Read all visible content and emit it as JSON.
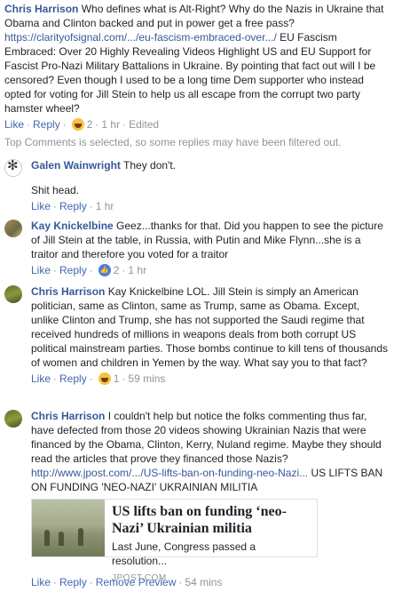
{
  "first_comment": {
    "author": "Chris Harrison",
    "text_part1": " Who defines what is Alt-Right? Why do the Nazis in Ukraine that Obama and Clinton backed and put in power get a free pass? ",
    "link": "https://clarityofsignal.com/.../eu-fascism-embraced-over.../",
    "text_part2": " EU Fascism Embraced: Over 20 Highly Revealing Videos Highlight US and EU Support for Fascist Pro-Nazi Military Battalions in Ukraine. By pointing that fact out will I be censored? Even though I used to be a long time Dem supporter who instead opted for voting for Jill Stein to help us all escape from the corrupt two party hamster wheel?",
    "actions": {
      "like": "Like",
      "reply": "Reply",
      "reaction_count": "2",
      "time": "1 hr",
      "edited": "Edited"
    }
  },
  "filter_note": "Top Comments is selected, so some replies may have been filtered out.",
  "replies": [
    {
      "author": "Galen Wainwright",
      "text": " They don't.",
      "text2": "Shit head.",
      "actions": {
        "like": "Like",
        "reply": "Reply",
        "time": "1 hr"
      }
    },
    {
      "author": "Kay Knickelbine",
      "text": " Geez...thanks for that. Did you happen to see the picture of Jill Stein at the table, in Russia, with Putin and Mike Flynn...she is a traitor and therefore you voted for a traitor",
      "actions": {
        "like": "Like",
        "reply": "Reply",
        "reaction_count": "2",
        "time": "1 hr"
      }
    },
    {
      "author": "Chris Harrison",
      "text": " Kay Knickelbine LOL. Jill Stein is simply an American politician, same as Clinton, same as Trump, same as Obama. Except, unlike Clinton and Trump, she has not supported the Saudi regime that received hundreds of millions in weapons deals from both corrupt US political mainstream parties. Those bombs continue to kill tens of thousands of women and children in Yemen by the way. What say you to that fact?",
      "actions": {
        "like": "Like",
        "reply": "Reply",
        "reaction_count": "1",
        "time": "59 mins"
      }
    },
    {
      "author": "Chris Harrison",
      "text": " I couldn't help but notice the folks commenting thus far, have defected from those 20 videos showing Ukrainian Nazis that were financed by the Obama, Clinton, Kerry, Nuland regime. Maybe they should read the articles that prove they financed those Nazis? ",
      "link": "http://www.jpost.com/.../US-lifts-ban-on-funding-neo-Nazi...",
      "text_after": " US LIFTS BAN ON FUNDING 'NEO-NAZI' UKRAINIAN MILITIA",
      "preview": {
        "title": "US lifts ban on funding ‘neo-Nazi’ Ukrainian militia",
        "desc": "Last June, Congress passed a resolution...",
        "source": "JPOST.COM"
      },
      "actions": {
        "like": "Like",
        "reply": "Reply",
        "remove_preview": "Remove Preview",
        "time": "54 mins"
      }
    }
  ],
  "colors": {
    "link": "#365899",
    "action": "#4267b2",
    "meta": "#90949c",
    "text": "#1d2129"
  },
  "icons": {
    "haha": "haha-reaction-icon",
    "like": "like-reaction-icon"
  }
}
